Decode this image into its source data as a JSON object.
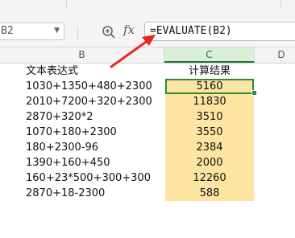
{
  "formula_bar": {
    "name_box_value": "B2",
    "name_box_dropdown_icon": "chevron-down-icon",
    "zoom_icon": "zoom-icon",
    "fx_label": "fx",
    "formula_text": "=EVALUATE(B2)"
  },
  "columns": [
    {
      "label": "B",
      "active": false
    },
    {
      "label": "C",
      "active": true
    },
    {
      "label": "D",
      "active": false
    }
  ],
  "table": {
    "header_expression": "文本表达式",
    "header_result": "计算结果",
    "rows": [
      {
        "expression": "1030+1350+480+2300",
        "result": "5160"
      },
      {
        "expression": "2010+7200+320+2300",
        "result": "11830"
      },
      {
        "expression": "2870+320*2",
        "result": "3510"
      },
      {
        "expression": "1070+180+2300",
        "result": "3550"
      },
      {
        "expression": "180+2300-96",
        "result": "2384"
      },
      {
        "expression": "1390+160+450",
        "result": "2000"
      },
      {
        "expression": "160+23*500+300+300",
        "result": "12260"
      },
      {
        "expression": "2870+18-2300",
        "result": "588"
      }
    ]
  },
  "colors": {
    "result_fill": "#fde4a1",
    "selection_border": "#2d8a3a",
    "callout_arrow": "#e8291c"
  }
}
